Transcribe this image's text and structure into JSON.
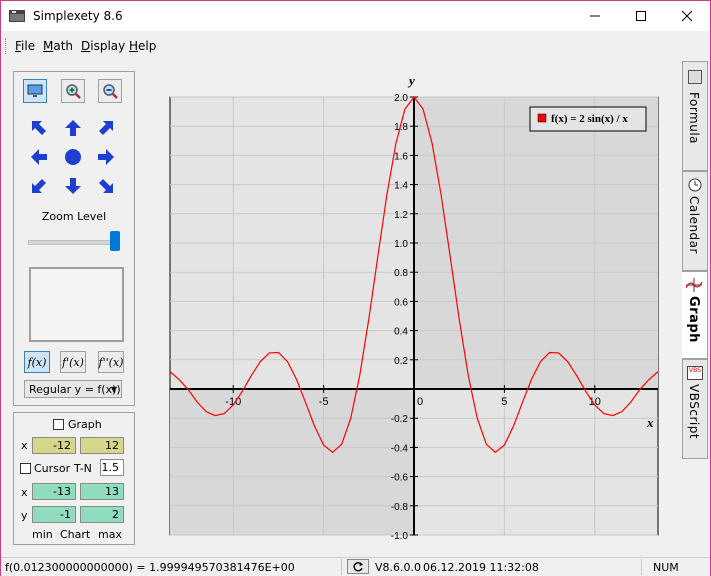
{
  "window": {
    "title": "Simplexety 8.6"
  },
  "menu": [
    {
      "pre": "",
      "acc": "F",
      "post": "ile"
    },
    {
      "pre": "",
      "acc": "M",
      "post": "ath"
    },
    {
      "pre": "",
      "acc": "D",
      "post": "isplay"
    },
    {
      "pre": "",
      "acc": "H",
      "post": "elp"
    }
  ],
  "left": {
    "zoom_label": "Zoom Level",
    "zoom_level": 0.95,
    "func_buttons": [
      "f(x)",
      "f'(x)",
      "f''(x)"
    ],
    "mode_select": "Regular y = f(x))"
  },
  "ranges": {
    "graph_label": "Graph",
    "graph_checked": false,
    "x_label": "x",
    "graph_x_min": "-12",
    "graph_x_max": "12",
    "cursor_label": "Cursor",
    "cursor_checked": false,
    "tn_label": "T-N",
    "tn_value": "1.5",
    "chart_x_label": "x",
    "chart_x_min": "-13",
    "chart_x_max": "13",
    "chart_y_label": "y",
    "chart_y_min": "-1",
    "chart_y_max": "2",
    "foot_min": "min",
    "foot_chart": "Chart",
    "foot_max": "max"
  },
  "tabs": [
    "Formula",
    "Calendar",
    "Graph",
    "VBScript"
  ],
  "active_tab": "Graph",
  "status": {
    "readout": "f(0.012300000000000) = 1.999949570381476E+00",
    "version": "V8.6.0.0",
    "datetime": "06.12.2019 11:32:08",
    "num": "NUM"
  },
  "colors": {
    "curve": "#ff0000",
    "shade": "#d8d8d8",
    "plot_bg": "#e4e4e4",
    "accent": "#0078d7",
    "arrow": "#1f3fd0"
  },
  "icons": [
    "monitor-icon",
    "zoom-in-icon",
    "zoom-out-icon",
    "arrow-up-left-icon",
    "arrow-up-icon",
    "arrow-up-right-icon",
    "arrow-left-icon",
    "center-dot-icon",
    "arrow-right-icon",
    "arrow-down-left-icon",
    "arrow-down-icon",
    "arrow-down-right-icon",
    "refresh-icon"
  ],
  "chart_data": {
    "type": "line",
    "function": "f(x) = 2 sin(x) / x",
    "legend": "f(x) = 2  sin(x) / x",
    "xlabel": "x",
    "ylabel": "y",
    "xlim": [
      -13.5,
      13.5
    ],
    "ylim": [
      -1.0,
      2.0
    ],
    "x_ticks": [
      -10,
      -5,
      0,
      5,
      10
    ],
    "y_ticks": [
      -1.0,
      -0.8,
      -0.6,
      -0.4,
      -0.2,
      0.2,
      0.4,
      0.6,
      0.8,
      1.0,
      1.2,
      1.4,
      1.6,
      1.8,
      2.0
    ],
    "grid": true,
    "legend_position": "top-right",
    "series": [
      {
        "x": [
          -13.5,
          -13,
          -12.5,
          -12,
          -11.5,
          -11,
          -10.5,
          -10,
          -9.5,
          -9,
          -8.5,
          -8,
          -7.5,
          -7,
          -6.5,
          -6,
          -5.5,
          -5,
          -4.5,
          -4,
          -3.5,
          -3,
          -2.5,
          -2,
          -1.5,
          -1,
          -0.5,
          0,
          0.5,
          1,
          1.5,
          2,
          2.5,
          3,
          3.5,
          4,
          4.5,
          5,
          5.5,
          6,
          6.5,
          7,
          7.5,
          8,
          8.5,
          9,
          9.5,
          10,
          10.5,
          11,
          11.5,
          12,
          12.5,
          13,
          13.5
        ],
        "y": [
          0.119,
          0.065,
          -0.003,
          -0.089,
          -0.155,
          -0.182,
          -0.168,
          -0.109,
          -0.016,
          0.092,
          0.188,
          0.247,
          0.25,
          0.188,
          0.066,
          -0.093,
          -0.256,
          -0.384,
          -0.434,
          -0.378,
          -0.2,
          0.094,
          0.479,
          0.909,
          1.33,
          1.683,
          1.918,
          2.0,
          1.918,
          1.683,
          1.33,
          0.909,
          0.479,
          0.094,
          -0.2,
          -0.378,
          -0.434,
          -0.384,
          -0.256,
          -0.093,
          0.066,
          0.188,
          0.25,
          0.247,
          0.188,
          0.092,
          -0.016,
          -0.109,
          -0.168,
          -0.182,
          -0.155,
          -0.089,
          -0.003,
          0.065,
          0.119
        ]
      }
    ]
  }
}
